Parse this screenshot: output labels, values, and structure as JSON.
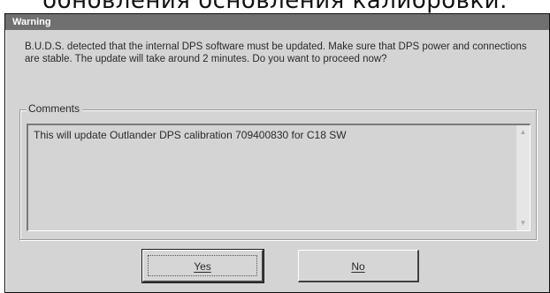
{
  "background_caption": "обновления основления калибровки.",
  "window": {
    "title": "Warning"
  },
  "message": "B.U.D.S. detected that the internal DPS software must be updated. Make sure that DPS power and connections are stable. The update will take around 2 minutes. Do you want to proceed now?",
  "comments": {
    "label": "Comments",
    "text": "This will update Outlander DPS calibration 709400830 for C18 SW"
  },
  "buttons": {
    "yes_label": "Yes",
    "no_label": "No"
  },
  "icons": {
    "scroll_up": "scroll-up-arrow-icon",
    "scroll_down": "scroll-down-arrow-icon"
  },
  "colors": {
    "titlebar": "#707070",
    "dialog_face": "#d4d4d4"
  }
}
